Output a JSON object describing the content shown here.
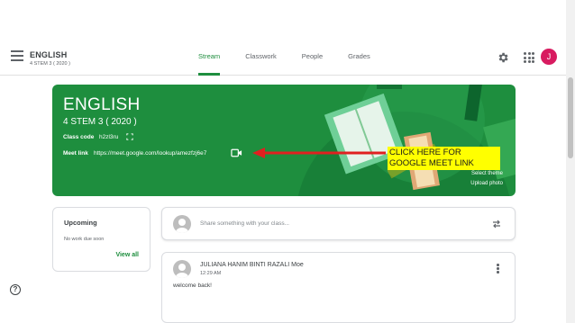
{
  "header": {
    "course_title": "ENGLISH",
    "course_subtitle": "4 STEM 3 ( 2020 )",
    "tabs": [
      {
        "label": "Stream",
        "active": true
      },
      {
        "label": "Classwork",
        "active": false
      },
      {
        "label": "People",
        "active": false
      },
      {
        "label": "Grades",
        "active": false
      }
    ],
    "avatar_initial": "J"
  },
  "banner": {
    "title": "ENGLISH",
    "subtitle": "4 STEM 3 ( 2020 )",
    "class_code_label": "Class code",
    "class_code": "h2zl3ru",
    "meet_link_label": "Meet link",
    "meet_link": "https://meet.google.com/lookup/amezfzj6e7",
    "select_theme": "Select theme",
    "upload_photo": "Upload photo",
    "color": "#1e8e3e"
  },
  "annotation": {
    "text": "CLICK HERE FOR GOOGLE MEET LINK",
    "highlight_color": "#ffff00",
    "arrow_color": "#e02020"
  },
  "upcoming": {
    "title": "Upcoming",
    "empty_text": "No work due soon",
    "view_all": "View all"
  },
  "share": {
    "placeholder": "Share something with your class..."
  },
  "post": {
    "author": "JULIANA HANIM BINTI RAZALI Moe",
    "time": "12:29 AM",
    "body": "welcome back!"
  },
  "icons": [
    "menu-icon",
    "gear-icon",
    "apps-icon",
    "fullscreen-icon",
    "video-icon",
    "repost-icon",
    "more-vert-icon",
    "help-icon"
  ]
}
